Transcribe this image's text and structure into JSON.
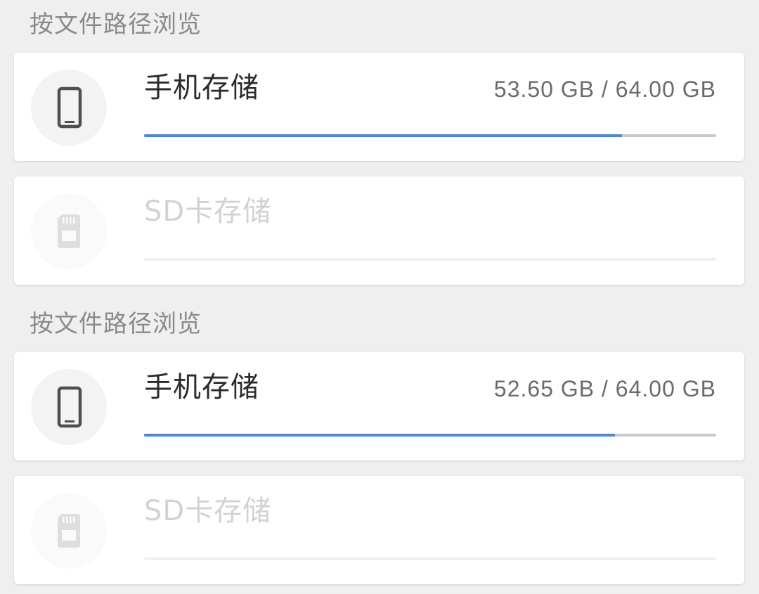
{
  "groups": [
    {
      "title": "按文件路径浏览",
      "internal": {
        "label": "手机存储",
        "size_text": "53.50 GB / 64.00 GB",
        "used_fraction": 0.8359,
        "icon": "phone-icon"
      },
      "sd": {
        "label": "SD卡存储",
        "icon": "sd-card-icon",
        "used_fraction": 0
      }
    },
    {
      "title": "按文件路径浏览",
      "internal": {
        "label": "手机存储",
        "size_text": "52.65 GB / 64.00 GB",
        "used_fraction": 0.8227,
        "icon": "phone-icon"
      },
      "sd": {
        "label": "SD卡存储",
        "icon": "sd-card-icon",
        "used_fraction": 0
      }
    }
  ],
  "colors": {
    "progress_fill": "#4f87d6",
    "progress_track": "#c8c8c8",
    "background": "#efefef"
  }
}
